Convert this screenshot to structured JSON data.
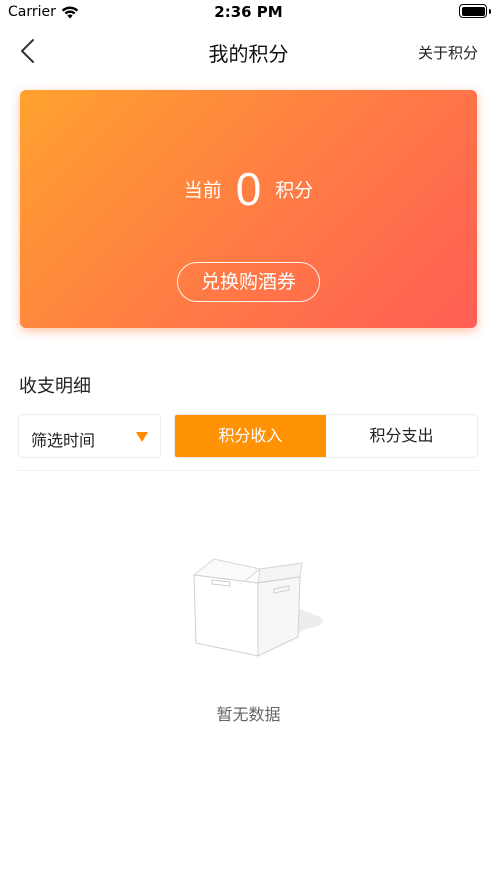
{
  "status_bar": {
    "carrier": "Carrier",
    "time": "2:36 PM"
  },
  "nav": {
    "title": "我的积分",
    "about_label": "关于积分",
    "back_icon": "chevron-left-icon"
  },
  "points_card": {
    "prefix": "当前",
    "value": "0",
    "suffix": "积分",
    "redeem_label": "兑换购酒券",
    "gradient_colors": [
      "#ffa22f",
      "#ff5e55"
    ]
  },
  "details": {
    "section_title": "收支明细",
    "filter_time_label": "筛选时间",
    "tabs": [
      {
        "label": "积分收入",
        "active": true
      },
      {
        "label": "积分支出",
        "active": false
      }
    ],
    "accent_color": "#ff9205"
  },
  "empty_state": {
    "icon": "empty-box-icon",
    "message": "暂无数据"
  }
}
